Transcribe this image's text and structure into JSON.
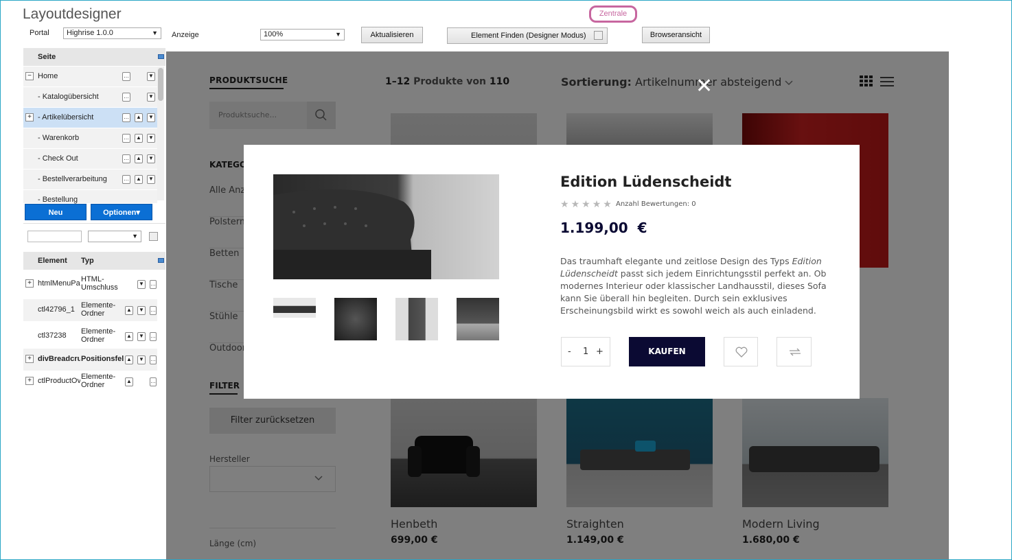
{
  "app": {
    "title": "Layoutdesigner",
    "zentrale": "Zentrale"
  },
  "toolbar": {
    "portal_label": "Portal",
    "portal_value": "Highrise 1.0.0",
    "anzeige_label": "Anzeige",
    "zoom_value": "100%",
    "refresh_label": "Aktualisieren",
    "find_label": "Element Finden (Designer Modus)",
    "browser_label": "Browseransicht"
  },
  "pages": {
    "header": "Seite",
    "items": [
      {
        "label": "Home",
        "expander": "−"
      },
      {
        "label": "- Katalogübersicht",
        "expander": ""
      },
      {
        "label": "- Artikelübersicht",
        "expander": "+"
      },
      {
        "label": "- Warenkorb",
        "expander": ""
      },
      {
        "label": "- Check Out",
        "expander": ""
      },
      {
        "label": "- Bestellverarbeitung",
        "expander": ""
      },
      {
        "label": "- Bestellung",
        "expander": ""
      }
    ],
    "new_label": "Neu",
    "options_label": "Optionen▾"
  },
  "elements": {
    "col_element": "Element",
    "col_type": "Typ",
    "rows": [
      {
        "name": "htmlMenuPa",
        "type": "HTML-Umschluss",
        "expander": "+",
        "bold": false
      },
      {
        "name": "ctl42796_1",
        "type": "Elemente-Ordner",
        "expander": "",
        "bold": false
      },
      {
        "name": "ctl37238",
        "type": "Elemente-Ordner",
        "expander": "",
        "bold": false
      },
      {
        "name": "divBreadcru",
        "type": "Positionsfel",
        "expander": "+",
        "bold": true
      },
      {
        "name": "ctlProductOv",
        "type": "Elemente-Ordner",
        "expander": "+",
        "bold": false
      }
    ]
  },
  "shop": {
    "search_heading": "PRODUKTSUCHE",
    "search_placeholder": "Produktsuche...",
    "category_heading": "KATEGORIEN",
    "categories": [
      "Alle Anzeigen",
      "Polstermöbel",
      "Betten",
      "Tische",
      "Stühle",
      "Outdoor"
    ],
    "filter_heading": "FILTER",
    "filter_reset": "Filter zurücksetzen",
    "manufacturer_label": "Hersteller",
    "length_label": "Länge (cm)",
    "count_range": "1–12",
    "count_mid": "Produkte von",
    "count_total": "110",
    "sort_label": "Sortierung:",
    "sort_value": "Artikelnummer absteigend",
    "products": [
      {
        "name": "Henbeth",
        "price": "699,00 €"
      },
      {
        "name": "Straighten",
        "price": "1.149,00 €"
      },
      {
        "name": "Modern Living",
        "price": "1.680,00 €"
      }
    ]
  },
  "modal": {
    "title": "Edition Lüdenscheidt",
    "rating_text": "Anzahl Bewertungen: 0",
    "rating_value": 0,
    "price": "1.199,00  €",
    "description_1": "Das traumhaft elegante und zeitlose Design des Typs ",
    "description_em": "Edition Lüdenscheidt",
    "description_2": " passt sich jedem Einrichtungsstil perfekt an. Ob modernes Interieur oder klassischer Landhausstil, dieses Sofa kann Sie überall hin begleiten. Durch sein exklusives Erscheinungsbild wirkt es sowohl weich als auch einladend.",
    "qty_minus": "-",
    "qty_value": "1",
    "qty_plus": "+",
    "buy_label": "KAUFEN",
    "close": "✕",
    "wish_icon": "heart-icon",
    "compare_icon": "compare-icon"
  },
  "colors": {
    "accent": "#0b6fd4",
    "buy": "#0b0a33",
    "zentrale": "#c7669f"
  }
}
